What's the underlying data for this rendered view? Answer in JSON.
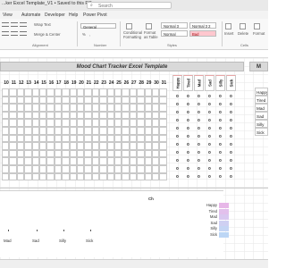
{
  "titlebar": {
    "title": "...ker Excel Template_V1 • Saved to this PC",
    "search_placeholder": "Search"
  },
  "menu": [
    "View",
    "Automate",
    "Developer",
    "Help",
    "Power Pivot"
  ],
  "ribbon": {
    "wrap_text": "Wrap Text",
    "merge_center": "Merge & Center",
    "alignment_label": "Alignment",
    "number_format": "General",
    "number_label": "Number",
    "conditional_formatting": "Conditional Formatting",
    "format_as_table": "Format as Table",
    "styles_label": "Styles",
    "style_normal3": "Normal 3",
    "style_normal32": "Normal 3 2",
    "style_normal": "Normal",
    "style_bad": "Bad",
    "insert": "Insert",
    "delete": "Delete",
    "format": "Format",
    "cells_label": "Cells",
    "percent_symbol": "%",
    "comma_symbol": ","
  },
  "sheet": {
    "tracker_title": "Mood Chart Tracker Excel Template",
    "right_title_fragment": "M",
    "days": [
      "10",
      "11",
      "12",
      "13",
      "14",
      "15",
      "16",
      "17",
      "18",
      "19",
      "20",
      "21",
      "22",
      "23",
      "24",
      "25",
      "26",
      "27",
      "28",
      "29",
      "30",
      "31"
    ],
    "mood_columns": [
      "Happy",
      "Tired",
      "Mad",
      "Sad",
      "Silly",
      "Sick"
    ],
    "zero_value": "0",
    "right_list": [
      "Happy",
      "Tired",
      "Mad",
      "Sad",
      "Silly",
      "Sick"
    ],
    "chart_title_fragment": "Ch",
    "chart_xlabels": [
      "Mad",
      "Sad",
      "Silly",
      "Sick"
    ],
    "legend": [
      {
        "label": "Happy",
        "color": "#e7b7e8"
      },
      {
        "label": "Tired",
        "color": "#e2c0ec"
      },
      {
        "label": "Mad",
        "color": "#d9c8f0"
      },
      {
        "label": "Sad",
        "color": "#cfd0f2"
      },
      {
        "label": "Silly",
        "color": "#c5d5f4"
      },
      {
        "label": "Sick",
        "color": "#bcd6f5"
      }
    ]
  },
  "colors": {
    "header_fill": "#d9d9d9",
    "mood_red": "#e8a6a6"
  }
}
